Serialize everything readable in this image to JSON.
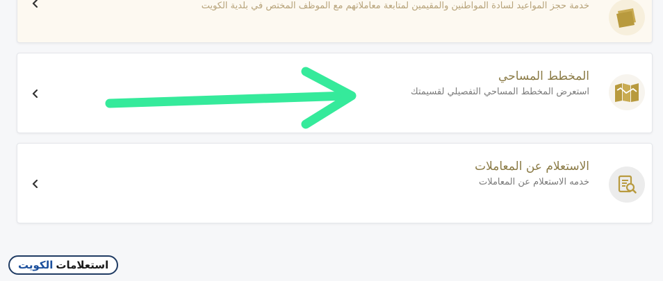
{
  "services": [
    {
      "icon": "document-stack-icon",
      "title": "",
      "subtitle": "خدمة حجز المواعيد لسادة المواطنين والمقيمين لمتابعة معاملاتهم مع الموظف المختص في بلدية الكويت"
    },
    {
      "icon": "map-icon",
      "title": "المخطط المساحي",
      "subtitle": "استعرض المخطط المساحي التفصيلي لقسيمتك"
    },
    {
      "icon": "document-search-icon",
      "title": "الاستعلام عن المعاملات",
      "subtitle": "خدمه الاستعلام عن المعاملات"
    }
  ],
  "watermark": {
    "part1": "استعلامات",
    "part2": "الكويت"
  },
  "colors": {
    "title": "#8a7a45",
    "icon_gold": "#b89a3e",
    "arrow": "#35ea9b",
    "badge_border": "#1f3b63",
    "badge_accent": "#1b4f9c"
  }
}
